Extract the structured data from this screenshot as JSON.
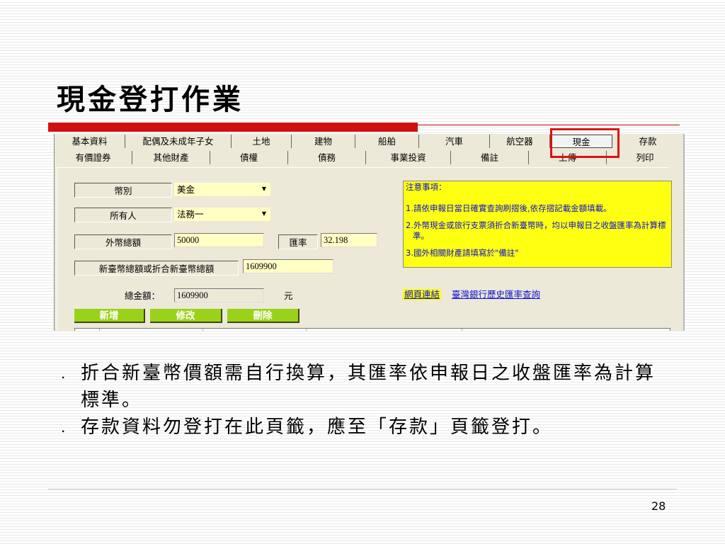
{
  "slide": {
    "title": "現金登打作業",
    "page_number": "28"
  },
  "tabs": {
    "row1": [
      "基本資料",
      "配偶及未成年子女",
      "土地",
      "建物",
      "船舶",
      "汽車",
      "航空器",
      "現金",
      "存款"
    ],
    "row2": [
      "有價證券",
      "其他財產",
      "債權",
      "債務",
      "事業投資",
      "備註",
      "上傳",
      "列印"
    ],
    "selected": "現金"
  },
  "form": {
    "currency_label": "幣別",
    "currency_value": "美金",
    "owner_label": "所有人",
    "owner_value": "法務一",
    "foreign_total_label": "外幣總額",
    "foreign_total_value": "50000",
    "rate_label": "匯率",
    "rate_value": "32.198",
    "ntd_total_label": "新臺幣總額或折合新臺幣總額",
    "ntd_total_value": "1609900",
    "grand_total_label": "總金額：",
    "grand_total_value": "1609900",
    "grand_total_unit": "元"
  },
  "notice": {
    "title": "注意事項：",
    "items": [
      "1.請依申報日當日確實查詢刷摺後,依存摺記載金額填載。",
      "2.外幣現金或旅行支票須折合新臺幣時，均以申報日之收盤匯率為計算標準。",
      "3.國外相關財產請填寫於\"備註\""
    ]
  },
  "links": {
    "web_link": "網頁連結",
    "bank_history": "臺灣銀行歷史匯率查詢"
  },
  "buttons": {
    "add": "新增",
    "edit": "修改",
    "delete": "刪除"
  },
  "bullets": [
    "折合新臺幣價額需自行換算，其匯率依申報日之收盤匯率為計算標準。",
    "存款資料勿登打在此頁籤，應至「存款」頁籤登打。"
  ],
  "colors": {
    "title_rule": "#d01010",
    "highlight": "#e01010",
    "button": "#9ad21a",
    "notice_bg": "#ffff12",
    "input_bg": "#ffffc4"
  }
}
